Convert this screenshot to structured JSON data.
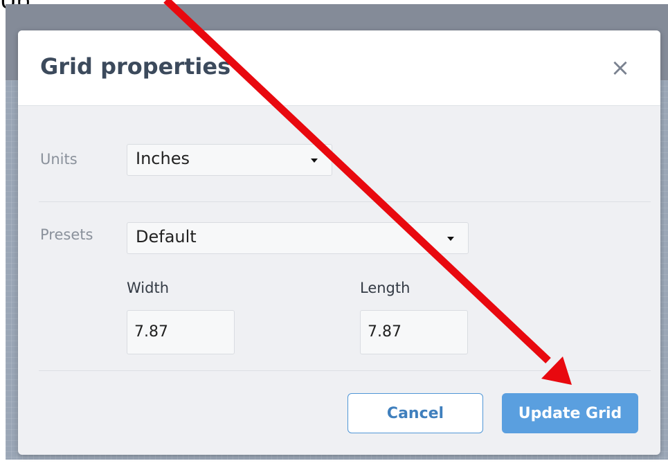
{
  "caption": {
    "text": "Up"
  },
  "dialog": {
    "title": "Grid properties",
    "close_icon": "close-icon",
    "units": {
      "label": "Units",
      "value": "Inches"
    },
    "presets": {
      "label": "Presets",
      "value": "Default"
    },
    "width": {
      "label": "Width",
      "value": "7.87"
    },
    "length": {
      "label": "Length",
      "value": "7.87"
    },
    "cancel_label": "Cancel",
    "update_label": "Update Grid"
  },
  "annotation": {
    "type": "red-arrow",
    "color": "#e8090f"
  },
  "colors": {
    "accent": "#5a9fdf",
    "title": "#3c4a5c",
    "backdrop": "#848b98"
  }
}
